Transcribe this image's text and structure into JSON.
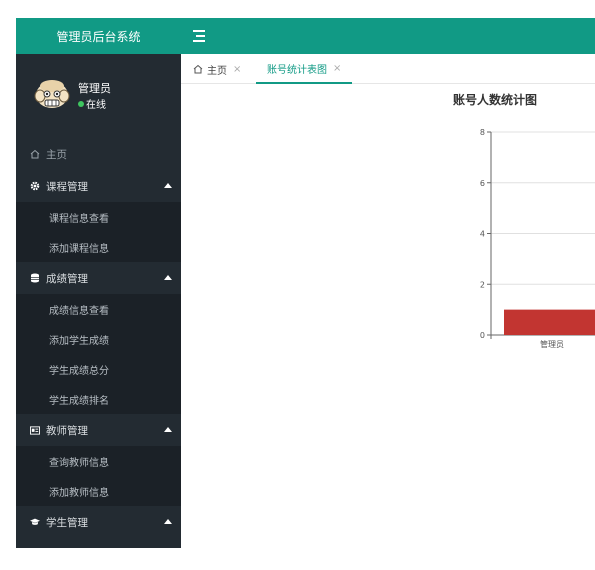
{
  "header": {
    "brand": "管理员后台系统"
  },
  "user": {
    "name": "管理员",
    "status": "在线"
  },
  "sidebar": {
    "home": "主页",
    "groups": [
      {
        "label": "课程管理",
        "icon": "gear-icon",
        "items": [
          "课程信息查看",
          "添加课程信息"
        ]
      },
      {
        "label": "成绩管理",
        "icon": "database-icon",
        "items": [
          "成绩信息查看",
          "添加学生成绩",
          "学生成绩总分",
          "学生成绩排名"
        ]
      },
      {
        "label": "教师管理",
        "icon": "id-card-icon",
        "items": [
          "查询教师信息",
          "添加教师信息"
        ]
      },
      {
        "label": "学生管理",
        "icon": "graduation-cap-icon",
        "items": []
      }
    ]
  },
  "tabs": [
    {
      "label": "主页",
      "icon": "home-icon"
    },
    {
      "label": "账号统计表图",
      "active": true
    }
  ],
  "colors": {
    "accent": "#119a85",
    "sidebar": "#232b32",
    "bar": "#c23531"
  },
  "chart_data": {
    "type": "bar",
    "title": "账号人数统计图",
    "categories": [
      "管理员"
    ],
    "values": [
      1
    ],
    "ylim": [
      0,
      8
    ],
    "yticks": [
      0,
      2,
      4,
      6,
      8
    ],
    "grid": true
  }
}
